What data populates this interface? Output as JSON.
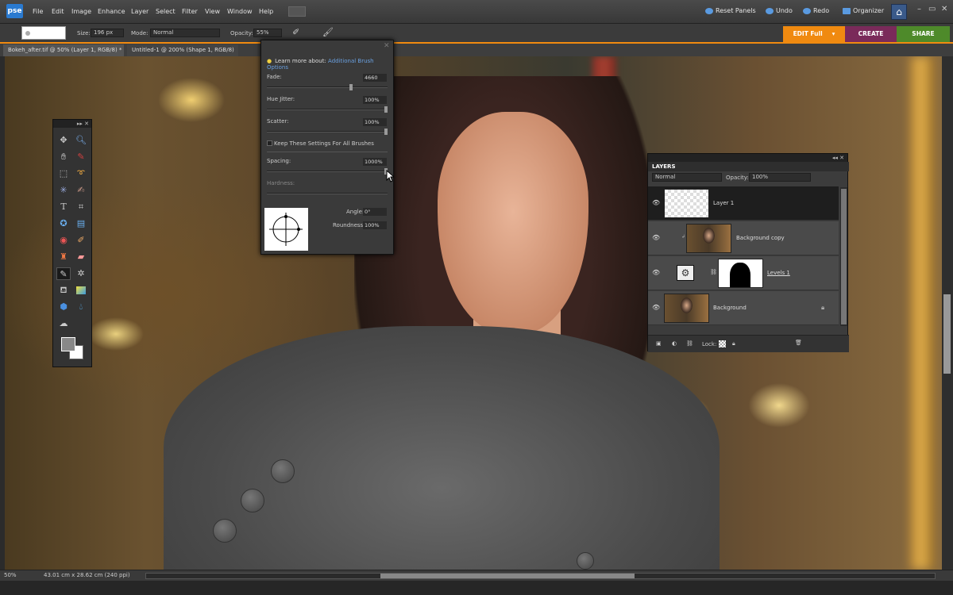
{
  "app": {
    "logo": "pse",
    "window_controls": [
      "–",
      "▭",
      "✕"
    ]
  },
  "menu": [
    "File",
    "Edit",
    "Image",
    "Enhance",
    "Layer",
    "Select",
    "Filter",
    "View",
    "Window",
    "Help"
  ],
  "topbar": {
    "reset_panels": "Reset Panels",
    "undo": "Undo",
    "redo": "Redo",
    "organizer": "Organizer"
  },
  "options": {
    "size_label": "Size:",
    "size_value": "196 px",
    "mode_label": "Mode:",
    "mode_value": "Normal",
    "opacity_label": "Opacity:",
    "opacity_value": "55%"
  },
  "modes": {
    "edit": "EDIT Full",
    "create": "CREATE",
    "share": "SHARE",
    "colors": {
      "edit": "#f08a10",
      "create": "#7a2a5a",
      "share": "#4e8a2a"
    }
  },
  "tabs": [
    {
      "label": "Bokeh_after.tif @ 50% (Layer 1, RGB/8) *",
      "close": "✕"
    },
    {
      "label": "Untitled-1 @ 200% (Shape 1, RGB/8) *",
      "close": "✕"
    }
  ],
  "status": {
    "zoom": "50%",
    "doc_size": "43.01 cm x 28.62 cm (240 ppi)"
  },
  "brush_dynamics": {
    "learn_prefix": "Learn more about:",
    "learn_link": "Additional Brush Options",
    "fade_label": "Fade:",
    "fade_value": "4660",
    "hue_label": "Hue Jitter:",
    "hue_value": "100%",
    "scatter_label": "Scatter:",
    "scatter_value": "100%",
    "keep_label": "Keep These Settings For All Brushes",
    "spacing_label": "Spacing:",
    "spacing_value": "1000%",
    "hardness_label": "Hardness:",
    "angle_label": "Angle:",
    "angle_value": "0°",
    "roundness_label": "Roundness:",
    "roundness_value": "100%"
  },
  "layers_panel": {
    "title": "LAYERS",
    "blend": "Normal",
    "opacity_label": "Opacity:",
    "opacity_value": "100%",
    "layers": [
      "Layer 1",
      "Background copy",
      "Levels 1",
      "Background"
    ],
    "lock_label": "Lock:"
  },
  "toolbox_icons": [
    "move-icon",
    "zoom-icon",
    "hand-icon",
    "eyedropper-icon",
    "marquee-icon",
    "lasso-icon",
    "magic-wand-icon",
    "quick-selection-icon",
    "type-icon",
    "crop-icon",
    "cookie-cutter-icon",
    "straighten-icon",
    "red-eye-icon",
    "spot-healing-icon",
    "clone-stamp-icon",
    "eraser-icon",
    "brush-icon",
    "impressionist-brush-icon",
    "paint-bucket-icon",
    "gradient-icon",
    "shape-icon",
    "blur-icon",
    "sponge-icon"
  ]
}
